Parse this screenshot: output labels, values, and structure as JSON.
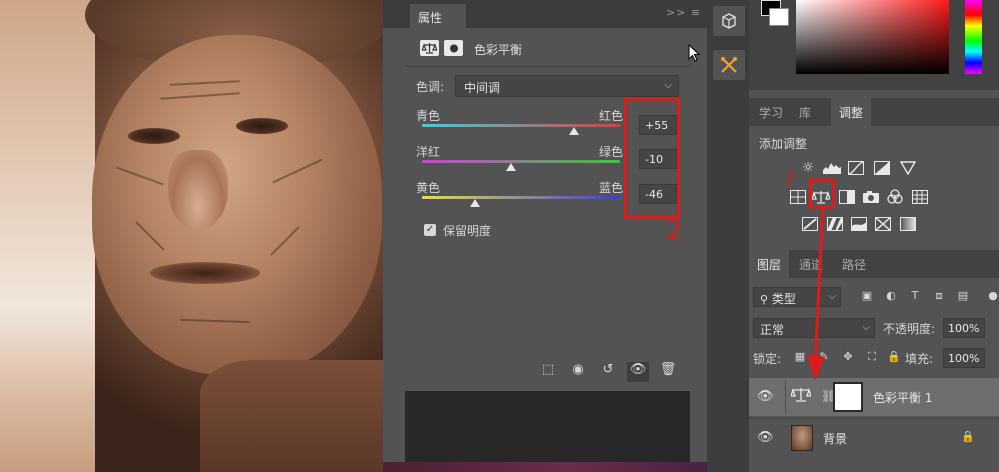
{
  "properties": {
    "tab_label": "属性",
    "panel_menu": ">> ≡",
    "adjustment_title": "色彩平衡",
    "tone_label": "色调:",
    "tone_value": "中间调",
    "sliders": [
      {
        "left": "青色",
        "right": "红色",
        "value": "+55",
        "position": 0.77
      },
      {
        "left": "洋红",
        "right": "绿色",
        "value": "-10",
        "position": 0.45
      },
      {
        "left": "黄色",
        "right": "蓝色",
        "value": "-46",
        "position": 0.27
      }
    ],
    "preserve_luminosity": "保留明度",
    "annotation_number": "2"
  },
  "adjustments_panel": {
    "tabs": [
      "学习",
      "库",
      "调整"
    ],
    "active_tab": "调整",
    "add_adjustment": "添加调整"
  },
  "layers_panel": {
    "tabs": [
      "图层",
      "通道",
      "路径"
    ],
    "active_tab": "图层",
    "filter_kind": "类型",
    "blend_mode": "正常",
    "opacity_label": "不透明度:",
    "opacity_value": "100%",
    "lock_label": "锁定:",
    "fill_label": "填充:",
    "fill_value": "100%",
    "layers": [
      {
        "name": "色彩平衡 1",
        "selected": true
      },
      {
        "name": "背景",
        "selected": false
      }
    ]
  },
  "colors": {
    "annotation_red": "#e0191b",
    "panel_bg": "#535353",
    "dark_bg": "#3c3c3c"
  }
}
